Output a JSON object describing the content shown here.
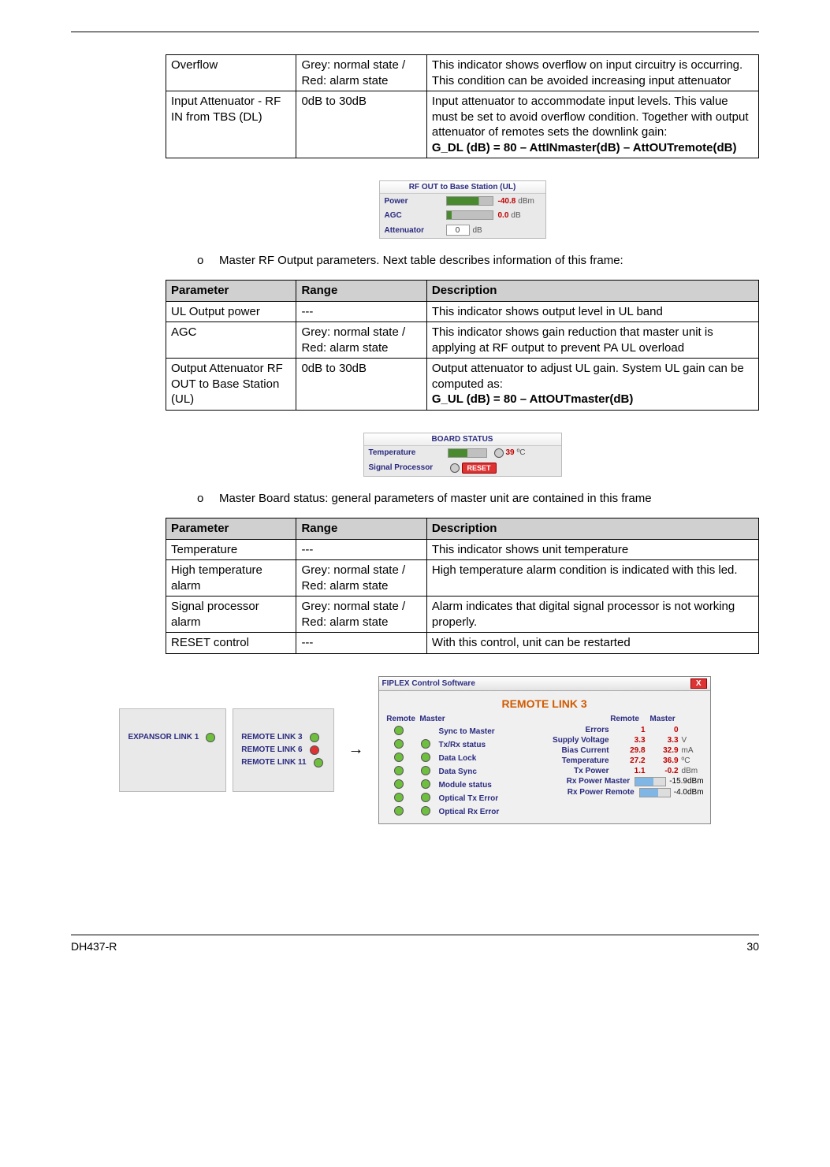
{
  "table1": {
    "rows": [
      {
        "param": "Overflow",
        "range": "Grey: normal state / Red: alarm state",
        "desc": "This indicator shows overflow on input circuitry is occurring. This condition can be avoided increasing input attenuator"
      },
      {
        "param": "Input Attenuator - RF IN from TBS (DL)",
        "range": "0dB to 30dB",
        "desc_plain": "Input attenuator to accommodate input levels. This value must be set to avoid overflow condition. Together with output attenuator of remotes sets the downlink gain:",
        "desc_bold": "G_DL (dB) = 80 – AttINmaster(dB) – AttOUTremote(dB)"
      }
    ]
  },
  "panel_rfout": {
    "title": "RF OUT to Base Station (UL)",
    "power_label": "Power",
    "power_value": "-40.8",
    "power_unit": "dBm",
    "agc_label": "AGC",
    "agc_value": "0.0",
    "agc_unit": "dB",
    "att_label": "Attenuator",
    "att_value": "0",
    "att_unit": "dB"
  },
  "bullet1": "Master RF Output parameters. Next table describes information of this frame:",
  "table2": {
    "headers": {
      "p": "Parameter",
      "r": "Range",
      "d": "Description"
    },
    "rows": [
      {
        "param": "UL Output power",
        "range": "---",
        "desc": "This indicator shows output level in UL band"
      },
      {
        "param": "AGC",
        "range": "Grey: normal state / Red: alarm state",
        "desc": "This indicator shows gain reduction that master unit is applying at RF output to prevent PA UL overload"
      },
      {
        "param": "Output Attenuator RF OUT to Base Station (UL)",
        "range": "0dB to 30dB",
        "desc_plain": "Output attenuator to adjust UL gain. System UL gain can be computed as:",
        "desc_bold": "G_UL (dB) = 80 – AttOUTmaster(dB)"
      }
    ]
  },
  "panel_board": {
    "title": "BOARD STATUS",
    "temp_label": "Temperature",
    "temp_value": "39",
    "temp_unit": "ºC",
    "sp_label": "Signal Processor",
    "reset": "RESET"
  },
  "bullet2": "Master Board status: general parameters of master unit are contained in this frame",
  "table3": {
    "headers": {
      "p": "Parameter",
      "r": "Range",
      "d": "Description"
    },
    "rows": [
      {
        "param": "Temperature",
        "range": "---",
        "desc": "This indicator shows unit temperature"
      },
      {
        "param": "High temperature alarm",
        "range": "Grey: normal state / Red: alarm state",
        "desc": "High temperature alarm condition is indicated with this led."
      },
      {
        "param": "Signal processor alarm",
        "range": "Grey: normal state / Red: alarm state",
        "desc": "Alarm indicates that digital signal processor is not working properly."
      },
      {
        "param": "RESET control",
        "range": "---",
        "desc": "With this control, unit can be restarted"
      }
    ]
  },
  "expansor": {
    "label": "EXPANSOR LINK 1",
    "items": [
      {
        "label": "REMOTE LINK 3",
        "state": "green"
      },
      {
        "label": "REMOTE LINK 6",
        "state": "red"
      },
      {
        "label": "REMOTE LINK 11",
        "state": "green"
      }
    ]
  },
  "arrow": "→",
  "win": {
    "app": "FIPLEX Control Software",
    "close": "X",
    "title": "REMOTE LINK 3",
    "col_hdr_remote": "Remote",
    "col_hdr_master": "Master",
    "status_lines": [
      "Sync to Master",
      "Tx/Rx status",
      "Data Lock",
      "Data Sync",
      "Module status",
      "Optical Tx Error",
      "Optical Rx Error"
    ],
    "kv": [
      {
        "k": "Errors",
        "v1": "1",
        "v2": "0",
        "u": ""
      },
      {
        "k": "Supply Voltage",
        "v1": "3.3",
        "v2": "3.3",
        "u": "V"
      },
      {
        "k": "Bias Current",
        "v1": "29.8",
        "v2": "32.9",
        "u": "mA"
      },
      {
        "k": "Temperature",
        "v1": "27.2",
        "v2": "36.9",
        "u": "ºC"
      },
      {
        "k": "Tx Power",
        "v1": "1.1",
        "v2": "-0.2",
        "u": "dBm"
      }
    ],
    "bars": [
      {
        "k": "Rx Power Master",
        "v": "-15.9",
        "u": "dBm"
      },
      {
        "k": "Rx Power Remote",
        "v": "-4.0",
        "u": "dBm"
      }
    ]
  },
  "footer": {
    "doc": "DH437-R",
    "page": "30"
  }
}
